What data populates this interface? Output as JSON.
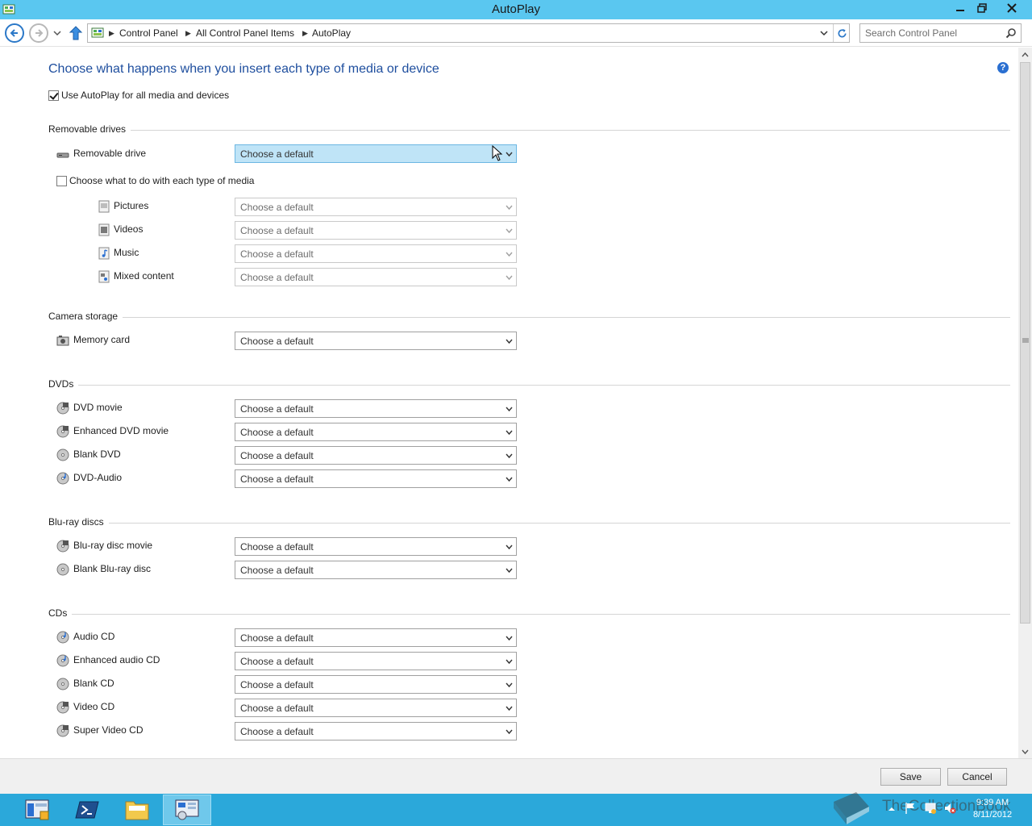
{
  "window": {
    "title": "AutoPlay",
    "controls": {
      "minimize": "minimize-icon",
      "maximize": "restore-icon",
      "close": "close-icon"
    }
  },
  "address": {
    "crumbs": [
      "Control Panel",
      "All Control Panel Items",
      "AutoPlay"
    ],
    "search_placeholder": "Search Control Panel"
  },
  "page": {
    "title": "Choose what happens when you insert each type of media or device",
    "use_autoplay_label": "Use AutoPlay for all media and devices",
    "use_autoplay_checked": true,
    "default_option": "Choose a default"
  },
  "sections": {
    "removable": {
      "title": "Removable drives",
      "drive_label": "Removable drive",
      "each_media_label": "Choose what to do with each type of media",
      "each_media_checked": false,
      "media": [
        "Pictures",
        "Videos",
        "Music",
        "Mixed content"
      ]
    },
    "camera": {
      "title": "Camera storage",
      "items": [
        "Memory card"
      ]
    },
    "dvds": {
      "title": "DVDs",
      "items": [
        "DVD movie",
        "Enhanced DVD movie",
        "Blank DVD",
        "DVD-Audio"
      ]
    },
    "bluray": {
      "title": "Blu-ray discs",
      "items": [
        "Blu-ray disc movie",
        "Blank Blu-ray disc"
      ]
    },
    "cds": {
      "title": "CDs",
      "items": [
        "Audio CD",
        "Enhanced audio CD",
        "Blank CD",
        "Video CD",
        "Super Video CD"
      ]
    }
  },
  "buttons": {
    "save": "Save",
    "cancel": "Cancel"
  },
  "taskbar": {
    "clock_time": "9:39 AM",
    "clock_date": "8/11/2012",
    "watermark": "TheCollectionBook"
  },
  "colors": {
    "titlebar": "#5ac7f0",
    "taskbar": "#2ba8da",
    "heading": "#1e4e9e",
    "hover": "#bfe4f7"
  }
}
